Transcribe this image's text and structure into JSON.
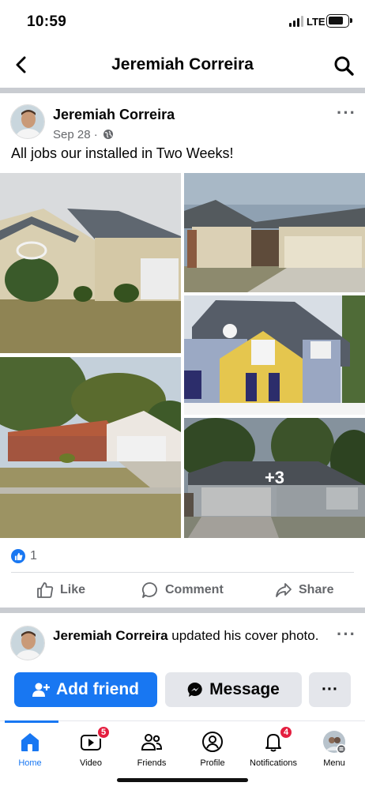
{
  "status_bar": {
    "time": "10:59",
    "network": "LTE"
  },
  "header": {
    "title": "Jeremiah Correira"
  },
  "post": {
    "author": "Jeremiah Correira",
    "date": "Sep 28 ·",
    "text": "All jobs our installed in Two Weeks!",
    "more_photos_label": "+3",
    "reaction_count": "1",
    "actions": {
      "like": "Like",
      "comment": "Comment",
      "share": "Share"
    }
  },
  "post2": {
    "author": "Jeremiah Correira",
    "text": " updated his cover photo."
  },
  "buttons": {
    "add_friend": "Add friend",
    "message": "Message",
    "more": "···"
  },
  "bottom_nav": [
    {
      "label": "Home",
      "badge": ""
    },
    {
      "label": "Video",
      "badge": "5"
    },
    {
      "label": "Friends",
      "badge": ""
    },
    {
      "label": "Profile",
      "badge": ""
    },
    {
      "label": "Notifications",
      "badge": "4"
    },
    {
      "label": "Menu",
      "badge": ""
    }
  ],
  "colors": {
    "accent": "#1877f2",
    "badge": "#e41e3f",
    "secondary_text": "#65676b"
  }
}
